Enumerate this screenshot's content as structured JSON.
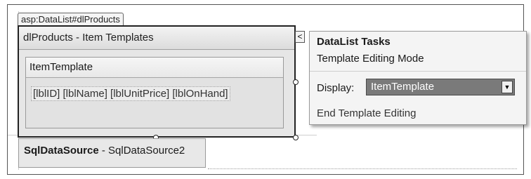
{
  "designer": {
    "control_tag": "asp:DataList#dlProducts",
    "datalist_header": "dlProducts - Item Templates",
    "item_template_label": "ItemTemplate",
    "item_template_content": "[lblID] [lblName] [lblUnitPrice] [lblOnHand]"
  },
  "smart_tag": {
    "glyph": "<"
  },
  "tasks_panel": {
    "title": "DataList Tasks",
    "mode": "Template Editing Mode",
    "display_label": "Display:",
    "display_value": "ItemTemplate",
    "dropdown_arrow": "▼",
    "end_link": "End Template Editing"
  },
  "datasource": {
    "type_label": "SqlDataSource",
    "name": " - SqlDataSource2"
  }
}
